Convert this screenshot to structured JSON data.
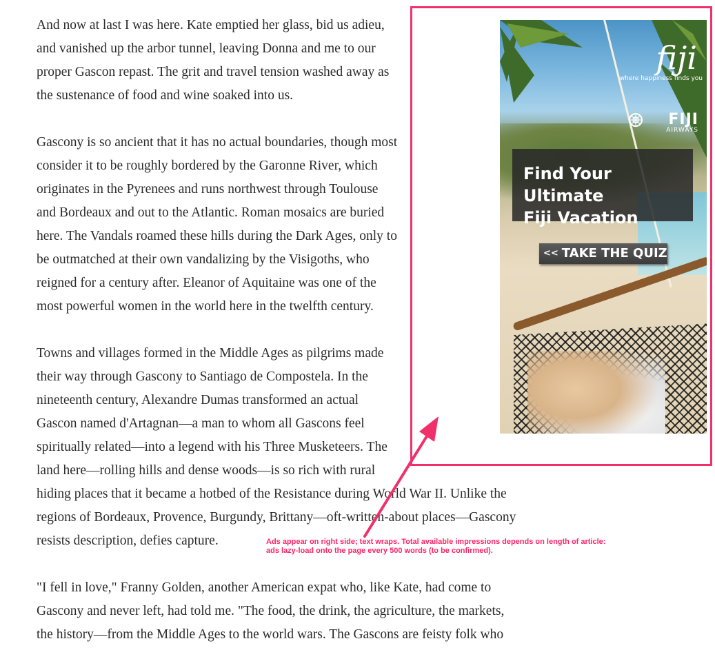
{
  "article": {
    "paragraphs": [
      {
        "lines": [
          "And now at last I was here. Kate emptied her glass, bid us adieu,",
          "and vanished up the arbor tunnel, leaving Donna and me to our",
          "proper Gascon repast. The grit and travel tension washed away as",
          "the sustenance of food and wine soaked into us."
        ]
      },
      {
        "lines": [
          "Gascony is so ancient that it has no actual boundaries, though most",
          "consider it to be roughly bordered by the Garonne River, which",
          "originates in the Pyrenees and runs northwest through Toulouse",
          "and Bordeaux and out to the Atlantic. Roman mosaics are buried",
          "here. The Vandals roamed these hills during the Dark Ages, only to",
          "be outmatched at their own vandalizing by the Visigoths, who",
          "reigned for a century after. Eleanor of Aquitaine was one of the",
          "most powerful women in the world here in the twelfth century."
        ]
      },
      {
        "lines": [
          "Towns and villages formed in the Middle Ages as pilgrims made",
          "their way through Gascony to Santiago de Compostela. In the",
          "nineteenth century, Alexandre Dumas transformed an actual",
          "Gascon named d'Artagnan—a man to whom all Gascons feel",
          "spiritually related—into a legend with his Three Musketeers. The",
          "land here—rolling hills and dense woods—is so rich with rural",
          "hiding places that it became a hotbed of the Resistance during World War II. Unlike the",
          "regions of Bordeaux, Provence, Burgundy, Brittany—oft-written-about places—Gascony",
          "resists description, defies capture."
        ]
      },
      {
        "lines": [
          "\"I fell in love,\" Franny Golden, another American expat who, like Kate, had come to",
          "Gascony and never left, had told me. \"The food, the drink, the agriculture, the markets,",
          "the history—from the Middle Ages to the world wars. The Gascons are feisty folk who"
        ]
      }
    ]
  },
  "ad": {
    "logo": "fiji",
    "tagline": "where happiness finds you",
    "airline_name": "FIJI",
    "airline_sub": "AIRWAYS",
    "headline_line1": "Find Your Ultimate",
    "headline_line2": "Fiji Vacation",
    "cta_arrow": "<<",
    "cta_label": "TAKE THE QUIZ"
  },
  "annotation": {
    "line1": "Ads appear on right side; text wraps. Total available impressions depends on length of article:",
    "line2": "ads lazy-load onto the page every 500 words (to be confirmed).",
    "color": "#f0306b"
  }
}
